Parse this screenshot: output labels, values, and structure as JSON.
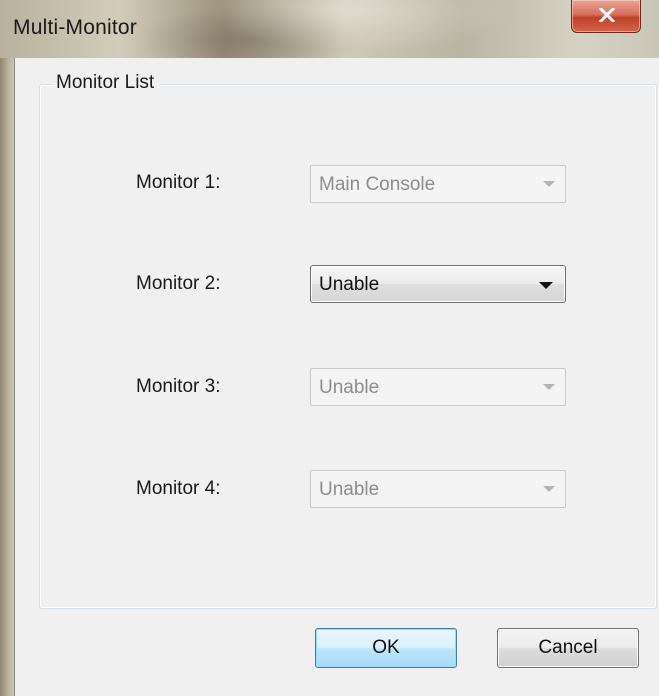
{
  "window": {
    "title": "Multi-Monitor",
    "close_glyph": "x"
  },
  "group": {
    "legend": "Monitor List"
  },
  "monitors": [
    {
      "label": "Monitor 1:",
      "value": "Main Console",
      "enabled": false
    },
    {
      "label": "Monitor 2:",
      "value": "Unable",
      "enabled": true
    },
    {
      "label": "Monitor 3:",
      "value": "Unable",
      "enabled": false
    },
    {
      "label": "Monitor 4:",
      "value": "Unable",
      "enabled": false
    }
  ],
  "buttons": {
    "ok_label": "OK",
    "cancel_label": "Cancel"
  },
  "icons": {
    "close": "close-icon",
    "dropdown": "chevron-down-icon"
  },
  "colors": {
    "close_button": "#c9503a",
    "default_button_border": "#3c7fb1",
    "disabled_text": "#8d8d8d"
  }
}
